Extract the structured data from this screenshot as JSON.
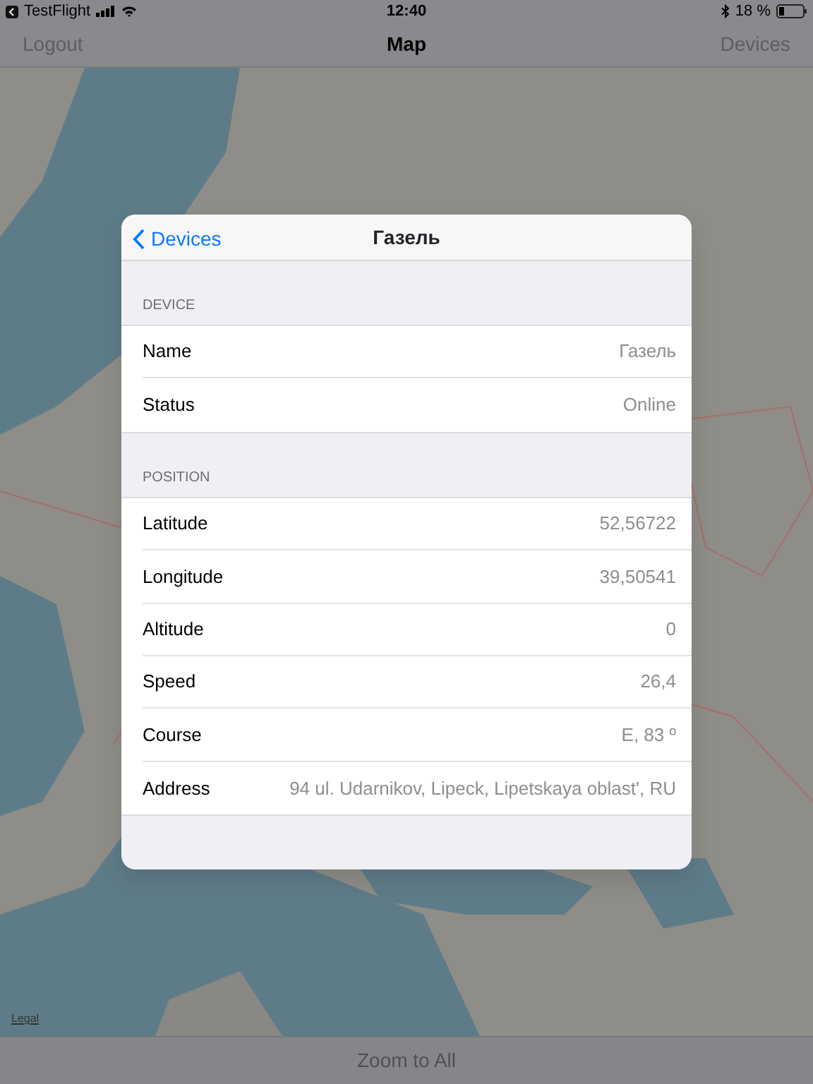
{
  "status_bar": {
    "back_app": "TestFlight",
    "time": "12:40",
    "battery": "18 %"
  },
  "nav_bar": {
    "left": "Logout",
    "title": "Map",
    "right": "Devices"
  },
  "map": {
    "kind": "picture",
    "legal": "Legal"
  },
  "toolbar": {
    "button": "Zoom to All"
  },
  "detail": {
    "back": "Devices",
    "title": "Газель",
    "sections": [
      {
        "header": "DEVICE",
        "rows": [
          {
            "label": "Name",
            "value": "Газель"
          },
          {
            "label": "Status",
            "value": "Online"
          }
        ]
      },
      {
        "header": "POSITION",
        "rows": [
          {
            "label": "Latitude",
            "value": "52,56722"
          },
          {
            "label": "Longitude",
            "value": "39,50541"
          },
          {
            "label": "Altitude",
            "value": "0"
          },
          {
            "label": "Speed",
            "value": "26,4"
          },
          {
            "label": "Course",
            "value": "E, 83 º"
          },
          {
            "label": "Address",
            "value": "94 ul. Udarnikov, Lipeck, Lipetskaya oblast', RU"
          }
        ]
      }
    ]
  }
}
